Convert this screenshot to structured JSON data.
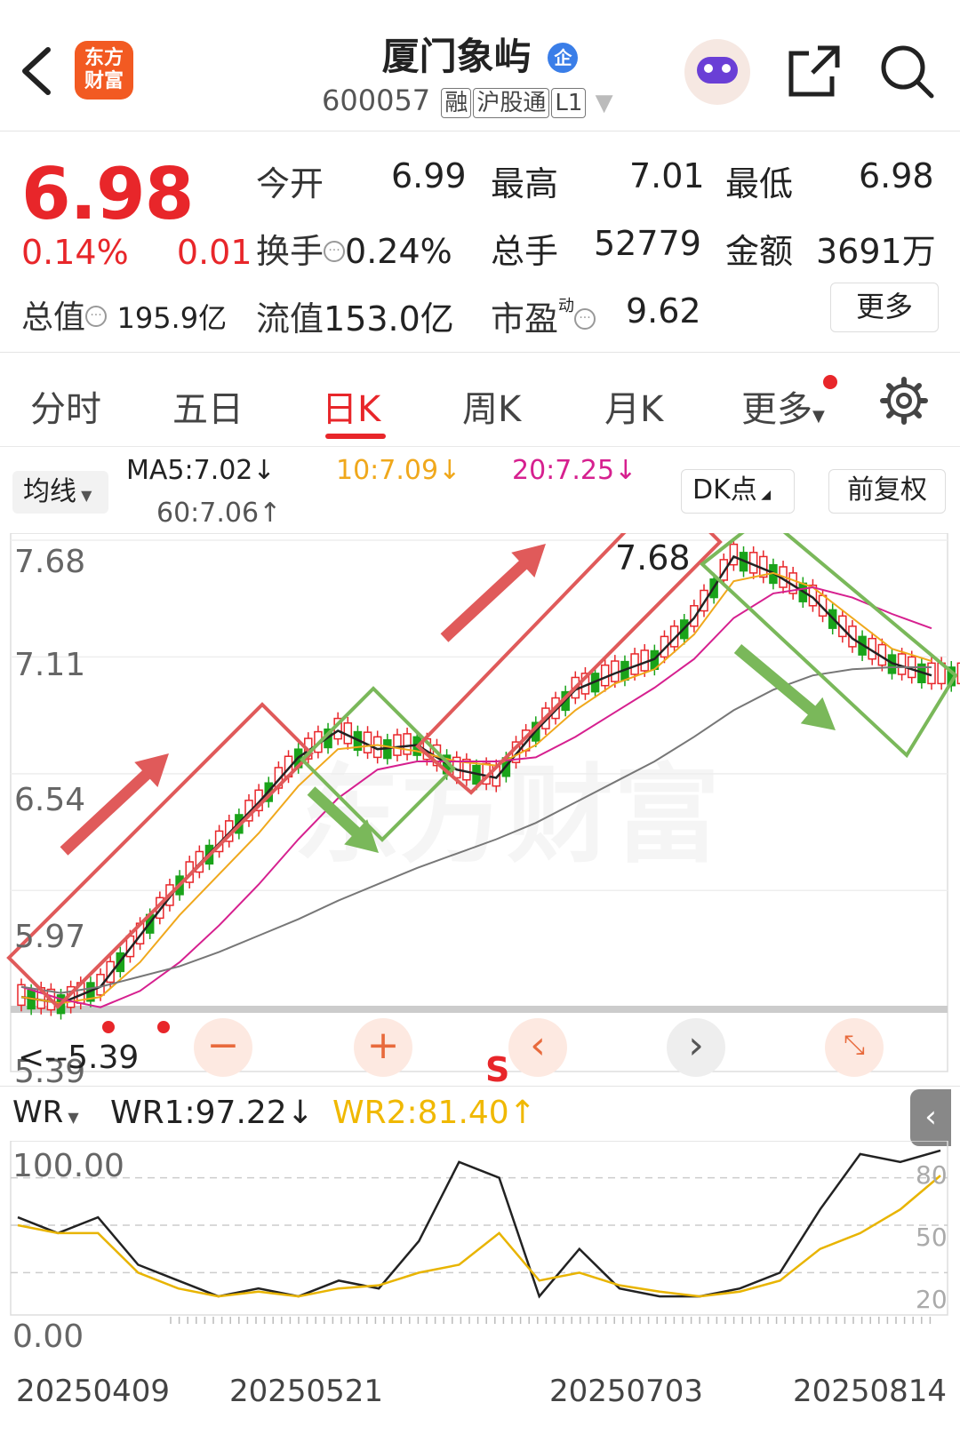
{
  "header": {
    "logo": "东方\n财富",
    "stock_name": "厦门象屿",
    "enterprise_badge": "企",
    "code": "600057",
    "tags": [
      "融",
      "沪股通",
      "L1"
    ]
  },
  "quote": {
    "price": "6.98",
    "change_pct": "0.14%",
    "change": "0.01",
    "open_label": "今开",
    "open": "6.99",
    "high_label": "最高",
    "high": "7.01",
    "low_label": "最低",
    "low": "6.98",
    "turnover_label": "换手",
    "turnover": "0.24%",
    "volume_label": "总手",
    "volume": "52779",
    "amount_label": "金额",
    "amount": "3691万",
    "mktcap_label": "总值",
    "mktcap": "195.9亿",
    "float_label": "流值",
    "float_cap": "153.0亿",
    "pe_label": "市盈",
    "pe_super": "动",
    "pe": "9.62",
    "more": "更多"
  },
  "tabs": [
    "分时",
    "五日",
    "日K",
    "周K",
    "月K",
    "更多"
  ],
  "active_tab": "日K",
  "indicators": {
    "ma_button": "均线",
    "ma5": "MA5:7.02↓",
    "ma10": "10:7.09↓",
    "ma20": "20:7.25↓",
    "ma60": "60:7.06↑",
    "dk": "DK点",
    "adjust": "前复权"
  },
  "kline": {
    "y_labels": [
      "7.68",
      "7.11",
      "6.54",
      "5.97",
      "5.39"
    ],
    "high_marker": "7.68",
    "low_marker": "5.39",
    "signal": "S"
  },
  "wr": {
    "button": "WR",
    "wr1": "WR1:97.22↓",
    "wr2": "WR2:81.40↑",
    "y_labels": [
      "100.00",
      "0.00"
    ],
    "right_labels": [
      "80",
      "50",
      "20"
    ]
  },
  "dates": [
    "20250409",
    "20250521",
    "20250703",
    "20250814"
  ],
  "colors": {
    "up": "#e8262a",
    "down": "#1aa31a",
    "ma5": "#222222",
    "ma10": "#f0a81c",
    "ma20": "#d6208f",
    "ma60": "#777777",
    "accent": "#e8262a"
  },
  "chart_data": {
    "type": "line",
    "title": "",
    "xlabel": "",
    "ylabel": "",
    "x_ticks": [
      "20250409",
      "20250521",
      "20250703",
      "20250814"
    ],
    "ylim": [
      5.39,
      7.68
    ],
    "y_ticks": [
      7.68,
      7.11,
      6.54,
      5.97,
      5.39
    ],
    "series": [
      {
        "name": "MA5",
        "values": [
          5.45,
          5.42,
          5.5,
          5.75,
          6.0,
          6.2,
          6.4,
          6.62,
          6.75,
          6.66,
          6.68,
          6.56,
          6.52,
          6.75,
          6.95,
          7.03,
          7.1,
          7.3,
          7.6,
          7.52,
          7.4,
          7.2,
          7.08,
          7.02
        ]
      },
      {
        "name": "MA10",
        "values": [
          5.45,
          5.42,
          5.45,
          5.62,
          5.85,
          6.05,
          6.25,
          6.48,
          6.66,
          6.68,
          6.65,
          6.6,
          6.58,
          6.68,
          6.85,
          6.98,
          7.05,
          7.22,
          7.48,
          7.52,
          7.45,
          7.3,
          7.15,
          7.09
        ]
      },
      {
        "name": "MA20",
        "values": [
          5.5,
          5.44,
          5.4,
          5.48,
          5.62,
          5.8,
          6.0,
          6.22,
          6.42,
          6.56,
          6.6,
          6.6,
          6.6,
          6.62,
          6.72,
          6.84,
          6.96,
          7.1,
          7.3,
          7.42,
          7.45,
          7.4,
          7.32,
          7.25
        ]
      },
      {
        "name": "MA60",
        "values": [
          5.5,
          5.47,
          5.5,
          5.55,
          5.6,
          5.67,
          5.75,
          5.83,
          5.92,
          6.0,
          6.08,
          6.15,
          6.22,
          6.3,
          6.4,
          6.5,
          6.6,
          6.72,
          6.85,
          6.95,
          7.02,
          7.05,
          7.06,
          7.06
        ]
      }
    ],
    "wr": {
      "ylim": [
        0,
        100
      ],
      "series": [
        {
          "name": "WR1",
          "values": [
            55,
            45,
            55,
            25,
            15,
            5,
            10,
            5,
            15,
            10,
            40,
            90,
            80,
            5,
            35,
            10,
            5,
            5,
            10,
            20,
            60,
            95,
            90,
            97.22
          ]
        },
        {
          "name": "WR2",
          "values": [
            50,
            45,
            45,
            20,
            10,
            5,
            8,
            5,
            10,
            12,
            20,
            25,
            45,
            15,
            20,
            12,
            8,
            5,
            8,
            15,
            35,
            45,
            60,
            81.4
          ]
        }
      ]
    }
  }
}
